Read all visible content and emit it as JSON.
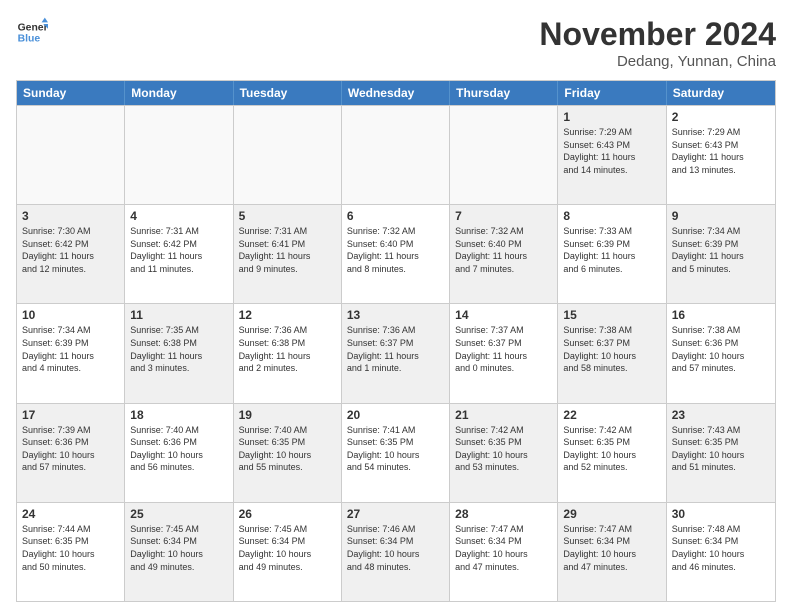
{
  "logo": {
    "line1": "General",
    "line2": "Blue"
  },
  "title": "November 2024",
  "location": "Dedang, Yunnan, China",
  "header_days": [
    "Sunday",
    "Monday",
    "Tuesday",
    "Wednesday",
    "Thursday",
    "Friday",
    "Saturday"
  ],
  "weeks": [
    {
      "cells": [
        {
          "day": "",
          "info": "",
          "empty": true
        },
        {
          "day": "",
          "info": "",
          "empty": true
        },
        {
          "day": "",
          "info": "",
          "empty": true
        },
        {
          "day": "",
          "info": "",
          "empty": true
        },
        {
          "day": "",
          "info": "",
          "empty": true
        },
        {
          "day": "1",
          "info": "Sunrise: 7:29 AM\nSunset: 6:43 PM\nDaylight: 11 hours\nand 14 minutes.",
          "shaded": true
        },
        {
          "day": "2",
          "info": "Sunrise: 7:29 AM\nSunset: 6:43 PM\nDaylight: 11 hours\nand 13 minutes.",
          "shaded": false
        }
      ]
    },
    {
      "cells": [
        {
          "day": "3",
          "info": "Sunrise: 7:30 AM\nSunset: 6:42 PM\nDaylight: 11 hours\nand 12 minutes.",
          "shaded": true
        },
        {
          "day": "4",
          "info": "Sunrise: 7:31 AM\nSunset: 6:42 PM\nDaylight: 11 hours\nand 11 minutes.",
          "shaded": false
        },
        {
          "day": "5",
          "info": "Sunrise: 7:31 AM\nSunset: 6:41 PM\nDaylight: 11 hours\nand 9 minutes.",
          "shaded": true
        },
        {
          "day": "6",
          "info": "Sunrise: 7:32 AM\nSunset: 6:40 PM\nDaylight: 11 hours\nand 8 minutes.",
          "shaded": false
        },
        {
          "day": "7",
          "info": "Sunrise: 7:32 AM\nSunset: 6:40 PM\nDaylight: 11 hours\nand 7 minutes.",
          "shaded": true
        },
        {
          "day": "8",
          "info": "Sunrise: 7:33 AM\nSunset: 6:39 PM\nDaylight: 11 hours\nand 6 minutes.",
          "shaded": false
        },
        {
          "day": "9",
          "info": "Sunrise: 7:34 AM\nSunset: 6:39 PM\nDaylight: 11 hours\nand 5 minutes.",
          "shaded": true
        }
      ]
    },
    {
      "cells": [
        {
          "day": "10",
          "info": "Sunrise: 7:34 AM\nSunset: 6:39 PM\nDaylight: 11 hours\nand 4 minutes.",
          "shaded": false
        },
        {
          "day": "11",
          "info": "Sunrise: 7:35 AM\nSunset: 6:38 PM\nDaylight: 11 hours\nand 3 minutes.",
          "shaded": true
        },
        {
          "day": "12",
          "info": "Sunrise: 7:36 AM\nSunset: 6:38 PM\nDaylight: 11 hours\nand 2 minutes.",
          "shaded": false
        },
        {
          "day": "13",
          "info": "Sunrise: 7:36 AM\nSunset: 6:37 PM\nDaylight: 11 hours\nand 1 minute.",
          "shaded": true
        },
        {
          "day": "14",
          "info": "Sunrise: 7:37 AM\nSunset: 6:37 PM\nDaylight: 11 hours\nand 0 minutes.",
          "shaded": false
        },
        {
          "day": "15",
          "info": "Sunrise: 7:38 AM\nSunset: 6:37 PM\nDaylight: 10 hours\nand 58 minutes.",
          "shaded": true
        },
        {
          "day": "16",
          "info": "Sunrise: 7:38 AM\nSunset: 6:36 PM\nDaylight: 10 hours\nand 57 minutes.",
          "shaded": false
        }
      ]
    },
    {
      "cells": [
        {
          "day": "17",
          "info": "Sunrise: 7:39 AM\nSunset: 6:36 PM\nDaylight: 10 hours\nand 57 minutes.",
          "shaded": true
        },
        {
          "day": "18",
          "info": "Sunrise: 7:40 AM\nSunset: 6:36 PM\nDaylight: 10 hours\nand 56 minutes.",
          "shaded": false
        },
        {
          "day": "19",
          "info": "Sunrise: 7:40 AM\nSunset: 6:35 PM\nDaylight: 10 hours\nand 55 minutes.",
          "shaded": true
        },
        {
          "day": "20",
          "info": "Sunrise: 7:41 AM\nSunset: 6:35 PM\nDaylight: 10 hours\nand 54 minutes.",
          "shaded": false
        },
        {
          "day": "21",
          "info": "Sunrise: 7:42 AM\nSunset: 6:35 PM\nDaylight: 10 hours\nand 53 minutes.",
          "shaded": true
        },
        {
          "day": "22",
          "info": "Sunrise: 7:42 AM\nSunset: 6:35 PM\nDaylight: 10 hours\nand 52 minutes.",
          "shaded": false
        },
        {
          "day": "23",
          "info": "Sunrise: 7:43 AM\nSunset: 6:35 PM\nDaylight: 10 hours\nand 51 minutes.",
          "shaded": true
        }
      ]
    },
    {
      "cells": [
        {
          "day": "24",
          "info": "Sunrise: 7:44 AM\nSunset: 6:35 PM\nDaylight: 10 hours\nand 50 minutes.",
          "shaded": false
        },
        {
          "day": "25",
          "info": "Sunrise: 7:45 AM\nSunset: 6:34 PM\nDaylight: 10 hours\nand 49 minutes.",
          "shaded": true
        },
        {
          "day": "26",
          "info": "Sunrise: 7:45 AM\nSunset: 6:34 PM\nDaylight: 10 hours\nand 49 minutes.",
          "shaded": false
        },
        {
          "day": "27",
          "info": "Sunrise: 7:46 AM\nSunset: 6:34 PM\nDaylight: 10 hours\nand 48 minutes.",
          "shaded": true
        },
        {
          "day": "28",
          "info": "Sunrise: 7:47 AM\nSunset: 6:34 PM\nDaylight: 10 hours\nand 47 minutes.",
          "shaded": false
        },
        {
          "day": "29",
          "info": "Sunrise: 7:47 AM\nSunset: 6:34 PM\nDaylight: 10 hours\nand 47 minutes.",
          "shaded": true
        },
        {
          "day": "30",
          "info": "Sunrise: 7:48 AM\nSunset: 6:34 PM\nDaylight: 10 hours\nand 46 minutes.",
          "shaded": false
        }
      ]
    }
  ]
}
